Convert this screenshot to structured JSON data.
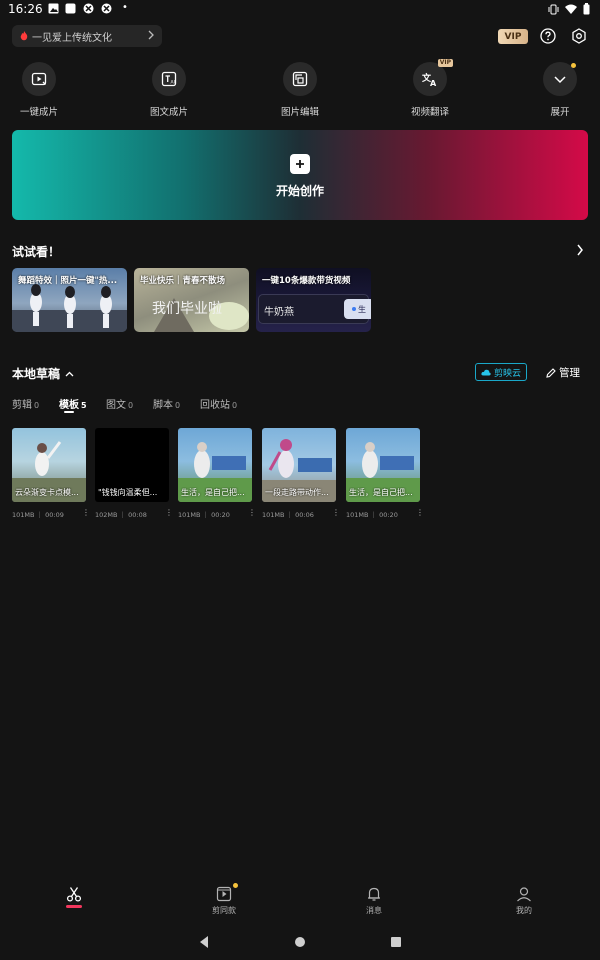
{
  "status_bar": {
    "time": "16:26"
  },
  "header": {
    "promo_text": "一见爱上传统文化",
    "vip_label": "VIP"
  },
  "quick_tools": [
    {
      "label": "一键成片",
      "icon": "auto-film-icon"
    },
    {
      "label": "图文成片",
      "icon": "text-to-video-icon"
    },
    {
      "label": "图片编辑",
      "icon": "image-edit-icon"
    },
    {
      "label": "视频翻译",
      "icon": "translate-icon",
      "badge": "VIP"
    },
    {
      "label": "展开",
      "icon": "chevron-down-icon"
    }
  ],
  "hero": {
    "title": "开始创作"
  },
  "try_section": {
    "title": "试试看！",
    "cards": [
      {
        "title": "舞蹈特效｜照片一键\"热..."
      },
      {
        "title": "毕业快乐｜青春不散场",
        "overlay": "我们毕业啦"
      },
      {
        "title": "一键10条爆款带货视频",
        "product": "牛奶燕",
        "chip": "生"
      }
    ]
  },
  "drafts": {
    "title": "本地草稿",
    "cloud_label": "剪映云",
    "manage_label": "管理",
    "tabs": [
      {
        "label": "剪辑",
        "count": "0"
      },
      {
        "label": "模板",
        "count": "5"
      },
      {
        "label": "图文",
        "count": "0"
      },
      {
        "label": "脚本",
        "count": "0"
      },
      {
        "label": "回收站",
        "count": "0"
      }
    ],
    "items": [
      {
        "title": "云朵渐变卡点模...",
        "meta": "101MB ｜ 00:09"
      },
      {
        "title": "\"钱钱向温柔但...",
        "meta": "102MB ｜ 00:08"
      },
      {
        "title": "生活，是自己把...",
        "meta": "101MB ｜ 00:20"
      },
      {
        "title": "一段走路带动作...",
        "meta": "101MB ｜ 00:06"
      },
      {
        "title": "生活，是自己把...",
        "meta": "101MB ｜ 00:20"
      }
    ]
  },
  "bottom_nav": [
    {
      "label": "",
      "icon": "scissors-icon"
    },
    {
      "label": "剪同款",
      "icon": "template-play-icon"
    },
    {
      "label": "消息",
      "icon": "bell-icon"
    },
    {
      "label": "我的",
      "icon": "profile-icon"
    }
  ],
  "colors": {
    "accent": "#f2375d",
    "cloud": "#27c3e8",
    "vip": "#e7c79d"
  }
}
